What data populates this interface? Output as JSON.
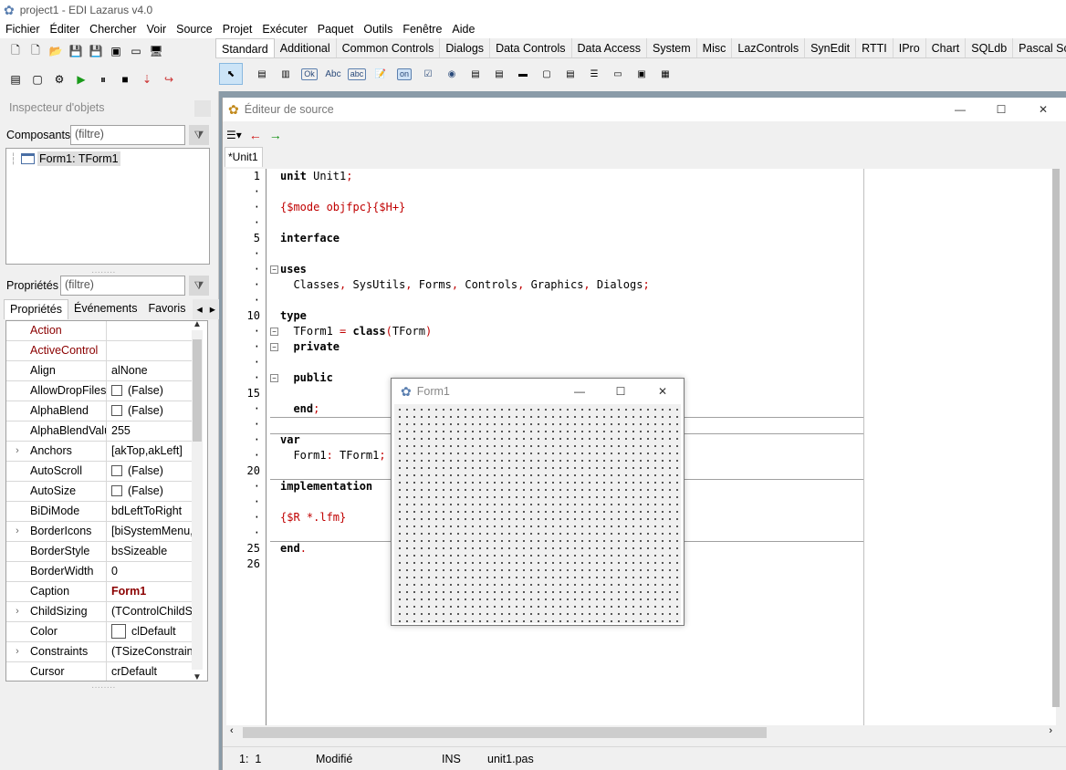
{
  "main_window": {
    "title": "project1  - EDI Lazarus v4.0",
    "menu": [
      "Fichier",
      "Éditer",
      "Chercher",
      "Voir",
      "Source",
      "Projet",
      "Exécuter",
      "Paquet",
      "Outils",
      "Fenêtre",
      "Aide"
    ],
    "palette_tabs": [
      "Standard",
      "Additional",
      "Common Controls",
      "Dialogs",
      "Data Controls",
      "Data Access",
      "System",
      "Misc",
      "LazControls",
      "SynEdit",
      "RTTI",
      "IPro",
      "Chart",
      "SQLdb",
      "Pascal Script"
    ],
    "active_tab": "Standard",
    "palette_labels": {
      "button": "Ok",
      "label": "Abc",
      "edit": "abc",
      "toggle": "on"
    }
  },
  "inspector": {
    "title": "Inspecteur d'objets",
    "components_label": "Composants",
    "filter_placeholder": "(filtre)",
    "tree_item": "Form1: TForm1",
    "properties_label": "Propriétés",
    "tabs": [
      "Propriétés",
      "Événements",
      "Favoris"
    ],
    "properties": [
      {
        "name": "Action",
        "value": "",
        "highlight": true,
        "expand": false,
        "check": false
      },
      {
        "name": "ActiveControl",
        "value": "",
        "highlight": true,
        "expand": false,
        "check": false
      },
      {
        "name": "Align",
        "value": "alNone",
        "highlight": false,
        "expand": false,
        "check": false
      },
      {
        "name": "AllowDropFiles",
        "value": "(False)",
        "highlight": false,
        "expand": false,
        "check": true
      },
      {
        "name": "AlphaBlend",
        "value": "(False)",
        "highlight": false,
        "expand": false,
        "check": true
      },
      {
        "name": "AlphaBlendValue",
        "value": "255",
        "highlight": false,
        "expand": false,
        "check": false
      },
      {
        "name": "Anchors",
        "value": "[akTop,akLeft]",
        "highlight": false,
        "expand": true,
        "check": false
      },
      {
        "name": "AutoScroll",
        "value": "(False)",
        "highlight": false,
        "expand": false,
        "check": true
      },
      {
        "name": "AutoSize",
        "value": "(False)",
        "highlight": false,
        "expand": false,
        "check": true
      },
      {
        "name": "BiDiMode",
        "value": "bdLeftToRight",
        "highlight": false,
        "expand": false,
        "check": false
      },
      {
        "name": "BorderIcons",
        "value": "[biSystemMenu,biMinimize]",
        "highlight": false,
        "expand": true,
        "check": false
      },
      {
        "name": "BorderStyle",
        "value": "bsSizeable",
        "highlight": false,
        "expand": false,
        "check": false
      },
      {
        "name": "BorderWidth",
        "value": "0",
        "highlight": false,
        "expand": false,
        "check": false
      },
      {
        "name": "Caption",
        "value": "Form1",
        "highlight": false,
        "expand": false,
        "check": false,
        "bold": true
      },
      {
        "name": "ChildSizing",
        "value": "(TControlChildSizing)",
        "highlight": false,
        "expand": true,
        "check": false
      },
      {
        "name": "Color",
        "value": "clDefault",
        "highlight": false,
        "expand": false,
        "check": true
      },
      {
        "name": "Constraints",
        "value": "(TSizeConstraints)",
        "highlight": false,
        "expand": true,
        "check": false
      },
      {
        "name": "Cursor",
        "value": "crDefault",
        "highlight": false,
        "expand": false,
        "check": false
      }
    ]
  },
  "editor": {
    "title": "Éditeur de source",
    "tab": "*Unit1",
    "line_numbers": [
      "1",
      "·",
      "·",
      "·",
      "5",
      "·",
      "·",
      "·",
      "·",
      "10",
      "·",
      "·",
      "·",
      "·",
      "15",
      "·",
      "·",
      "·",
      "·",
      "20",
      "·",
      "·",
      "·",
      "·",
      "25",
      "26"
    ],
    "status": {
      "position": "1:  1",
      "state": "Modifié",
      "mode": "INS",
      "file": "unit1.pas"
    }
  },
  "form1": {
    "title": "Form1"
  }
}
